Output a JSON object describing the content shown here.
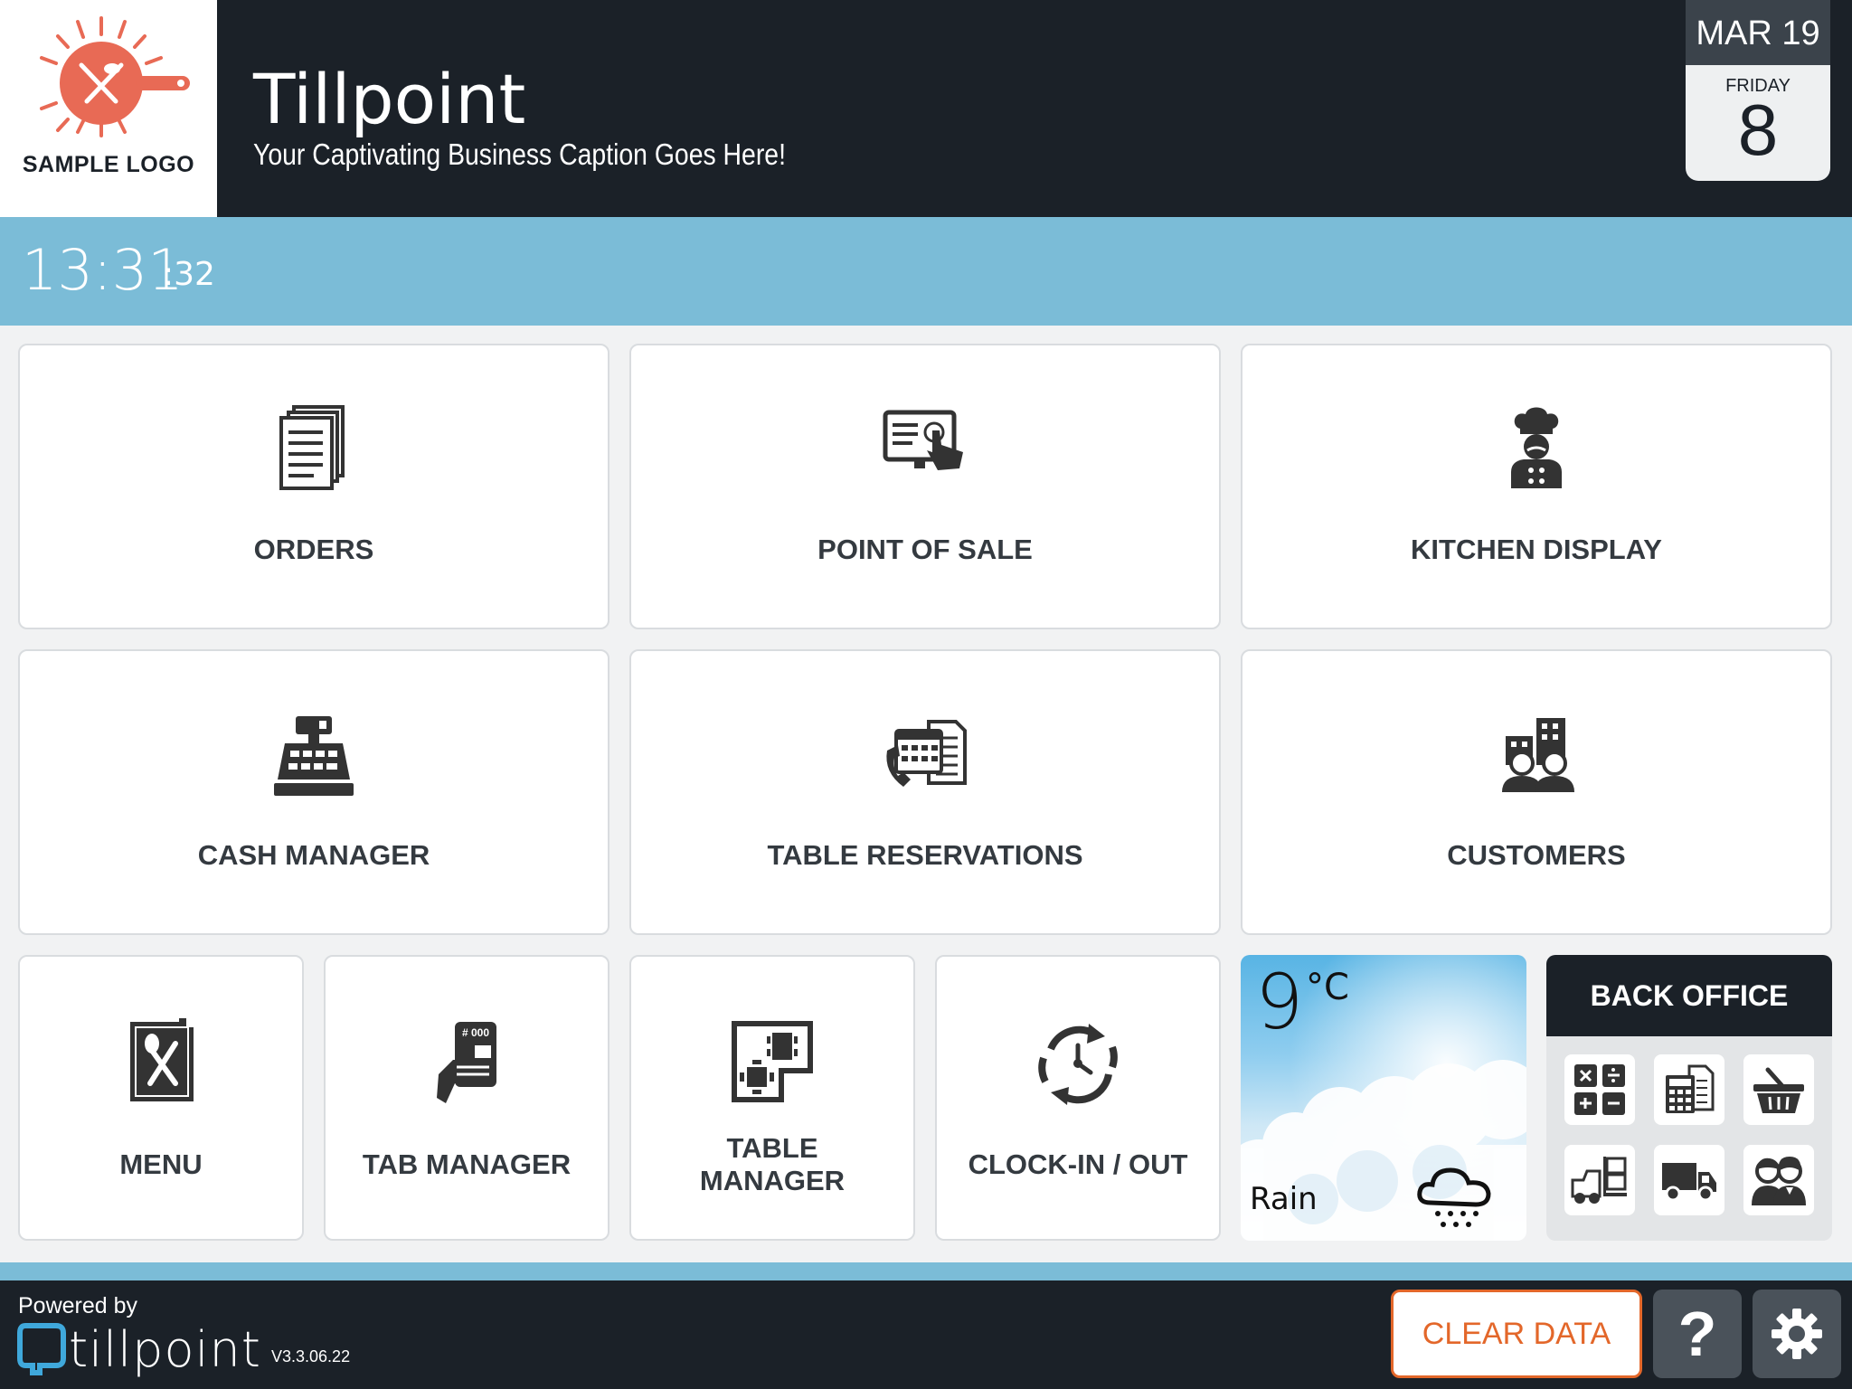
{
  "header": {
    "logo_text": "SAMPLE LOGO",
    "title": "Tillpoint",
    "caption": "Your Captivating Business Caption Goes Here!"
  },
  "calendar": {
    "month": "MAR 19",
    "weekday": "FRIDAY",
    "day": "8"
  },
  "clock": {
    "time": "13:31",
    "seconds": ":32"
  },
  "tiles": [
    {
      "label": "ORDERS",
      "icon": "documents-icon"
    },
    {
      "label": "POINT OF SALE",
      "icon": "touch-screen-icon"
    },
    {
      "label": "KITCHEN DISPLAY",
      "icon": "chef-icon"
    },
    {
      "label": "CASH MANAGER",
      "icon": "cash-register-icon"
    },
    {
      "label": "TABLE RESERVATIONS",
      "icon": "reservation-calendar-icon"
    },
    {
      "label": "CUSTOMERS",
      "icon": "customers-icon"
    },
    {
      "label": "MENU",
      "icon": "menu-book-icon"
    },
    {
      "label": "TAB MANAGER",
      "icon": "tab-card-icon"
    },
    {
      "label_line1": "TABLE",
      "label_line2": "MANAGER",
      "icon": "floor-plan-icon"
    },
    {
      "label": "CLOCK-IN / OUT",
      "icon": "clock-cycle-icon"
    }
  ],
  "tab_badge": "# 000",
  "weather": {
    "temp": "9",
    "unit": "°C",
    "condition": "Rain",
    "icon": "rain-cloud-icon"
  },
  "back_office": {
    "title": "BACK OFFICE",
    "buttons": [
      "calculator-icon",
      "spreadsheet-icon",
      "basket-icon",
      "forklift-icon",
      "truck-icon",
      "staff-icon"
    ]
  },
  "footer": {
    "powered_by": "Powered by",
    "brand": "tillpoint",
    "version": "V3.3.06.22",
    "clear_data": "CLEAR DATA",
    "help": "?"
  },
  "colors": {
    "header_bg": "#1b2128",
    "accent_blue": "#7bbcd7",
    "clear_orange": "#e3672a"
  }
}
